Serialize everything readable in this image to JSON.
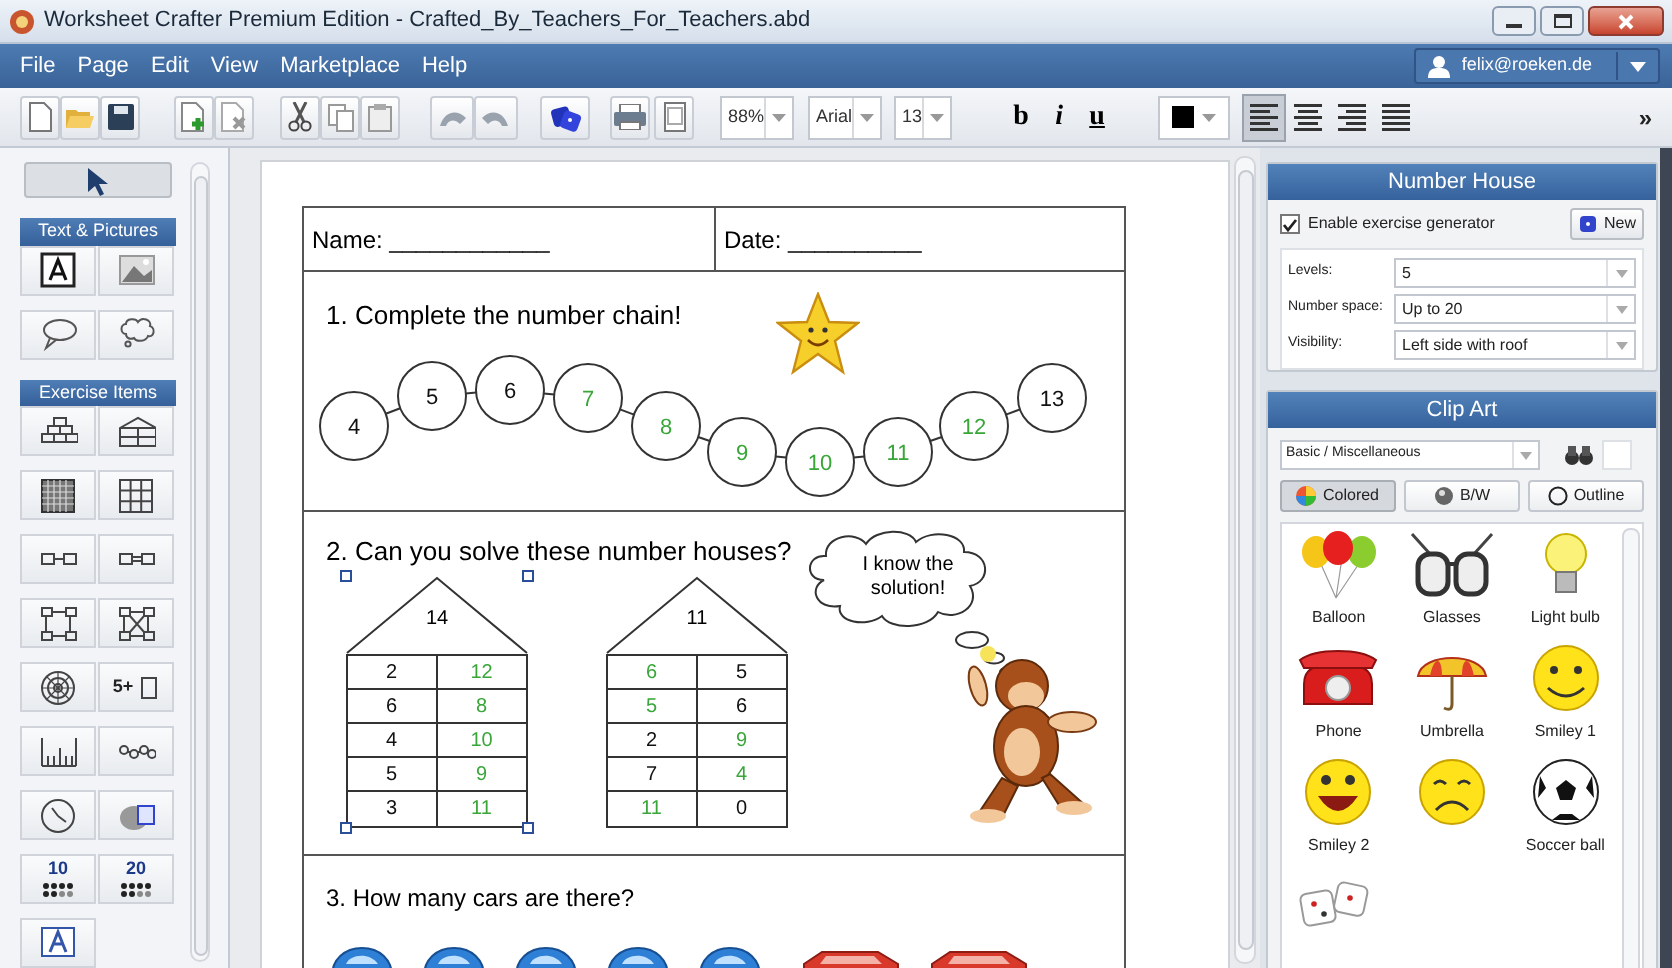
{
  "window": {
    "title": "Worksheet Crafter Premium Edition - Crafted_By_Teachers_For_Teachers.abd"
  },
  "menu": [
    "File",
    "Page",
    "Edit",
    "View",
    "Marketplace",
    "Help"
  ],
  "user": {
    "email": "felix@roeken.de"
  },
  "toolbar": {
    "zoom": "88%",
    "font": "Arial",
    "size": "13",
    "bold": "b",
    "italic": "i",
    "underline": "u",
    "more": "»",
    "align": [
      {
        "kind": "left",
        "selected": true
      },
      {
        "kind": "center",
        "selected": false
      },
      {
        "kind": "right",
        "selected": false
      },
      {
        "kind": "justify",
        "selected": false
      }
    ]
  },
  "toolbox": {
    "pointer": {
      "selected": true
    },
    "sections": [
      {
        "title": "Text & Pictures",
        "tools": [
          {
            "kind": "text"
          },
          {
            "kind": "picture"
          },
          {
            "kind": "speech"
          },
          {
            "kind": "thought"
          }
        ]
      },
      {
        "title": "Exercise Items",
        "tools": [
          {
            "kind": "pyramid"
          },
          {
            "kind": "house"
          },
          {
            "kind": "grid100"
          },
          {
            "kind": "grid9"
          },
          {
            "kind": "chain2"
          },
          {
            "kind": "chain2b"
          },
          {
            "kind": "cycle"
          },
          {
            "kind": "cycleb"
          },
          {
            "kind": "target"
          },
          {
            "kind": "equation",
            "label": "5+"
          },
          {
            "kind": "ruler"
          },
          {
            "kind": "beads"
          },
          {
            "kind": "clock"
          },
          {
            "kind": "elephant"
          },
          {
            "kind": "dots",
            "label": "10"
          },
          {
            "kind": "dots",
            "label": "20"
          },
          {
            "kind": "letters"
          }
        ]
      }
    ]
  },
  "worksheet": {
    "name": "Name: ____________",
    "date": "Date: __________",
    "task1": {
      "title": "1. Complete the number chain!",
      "chain": [
        {
          "value": "4",
          "kind": "given"
        },
        {
          "value": "5",
          "kind": "given"
        },
        {
          "value": "6",
          "kind": "given"
        },
        {
          "value": "7",
          "kind": "answer"
        },
        {
          "value": "8",
          "kind": "answer"
        },
        {
          "value": "9",
          "kind": "answer"
        },
        {
          "value": "10",
          "kind": "answer"
        },
        {
          "value": "11",
          "kind": "answer"
        },
        {
          "value": "12",
          "kind": "answer"
        },
        {
          "value": "13",
          "kind": "given"
        }
      ]
    },
    "task2": {
      "title": "2. Can you solve these number houses?",
      "bubble": "I know the solution!",
      "houses": [
        {
          "roof": "14",
          "selected": true,
          "rows": [
            [
              {
                "value": "2",
                "kind": "given"
              },
              {
                "value": "12",
                "kind": "answer"
              }
            ],
            [
              {
                "value": "6",
                "kind": "given"
              },
              {
                "value": "8",
                "kind": "answer"
              }
            ],
            [
              {
                "value": "4",
                "kind": "given"
              },
              {
                "value": "10",
                "kind": "answer"
              }
            ],
            [
              {
                "value": "5",
                "kind": "given"
              },
              {
                "value": "9",
                "kind": "answer"
              }
            ],
            [
              {
                "value": "3",
                "kind": "given"
              },
              {
                "value": "11",
                "kind": "answer"
              }
            ]
          ]
        },
        {
          "roof": "11",
          "selected": false,
          "rows": [
            [
              {
                "value": "6",
                "kind": "answer"
              },
              {
                "value": "5",
                "kind": "given"
              }
            ],
            [
              {
                "value": "5",
                "kind": "answer"
              },
              {
                "value": "6",
                "kind": "given"
              }
            ],
            [
              {
                "value": "2",
                "kind": "given"
              },
              {
                "value": "9",
                "kind": "answer"
              }
            ],
            [
              {
                "value": "7",
                "kind": "given"
              },
              {
                "value": "4",
                "kind": "answer"
              }
            ],
            [
              {
                "value": "11",
                "kind": "answer"
              },
              {
                "value": "0",
                "kind": "given"
              }
            ]
          ]
        }
      ]
    },
    "task3": {
      "title": "3. How many cars are there?"
    }
  },
  "number_house_panel": {
    "title": "Number House",
    "generator": {
      "label": "Enable exercise generator",
      "checked": true
    },
    "new_button": "New",
    "fields": [
      {
        "label": "Levels:",
        "value": "5"
      },
      {
        "label": "Number space:",
        "value": "Up to 20"
      },
      {
        "label": "Visibility:",
        "value": "Left side with roof"
      }
    ]
  },
  "clip_art_panel": {
    "title": "Clip Art",
    "category": "Basic / Miscellaneous",
    "styles": [
      {
        "label": "Colored",
        "kind": "colored",
        "selected": true
      },
      {
        "label": "B/W",
        "kind": "bw",
        "selected": false
      },
      {
        "label": "Outline",
        "kind": "outline",
        "selected": false
      }
    ],
    "items": [
      {
        "kind": "balloons",
        "label": "Balloon"
      },
      {
        "kind": "glasses",
        "label": "Glasses"
      },
      {
        "kind": "bulb",
        "label": "Light bulb"
      },
      {
        "kind": "phone",
        "label": "Phone"
      },
      {
        "kind": "umbrella",
        "label": "Umbrella"
      },
      {
        "kind": "smiley",
        "label": "Smiley 1"
      },
      {
        "kind": "laugh",
        "label": "Smiley 2"
      },
      {
        "kind": "sad"
      },
      {
        "kind": "ball",
        "label": "Soccer ball"
      },
      {
        "kind": "dice"
      }
    ]
  }
}
